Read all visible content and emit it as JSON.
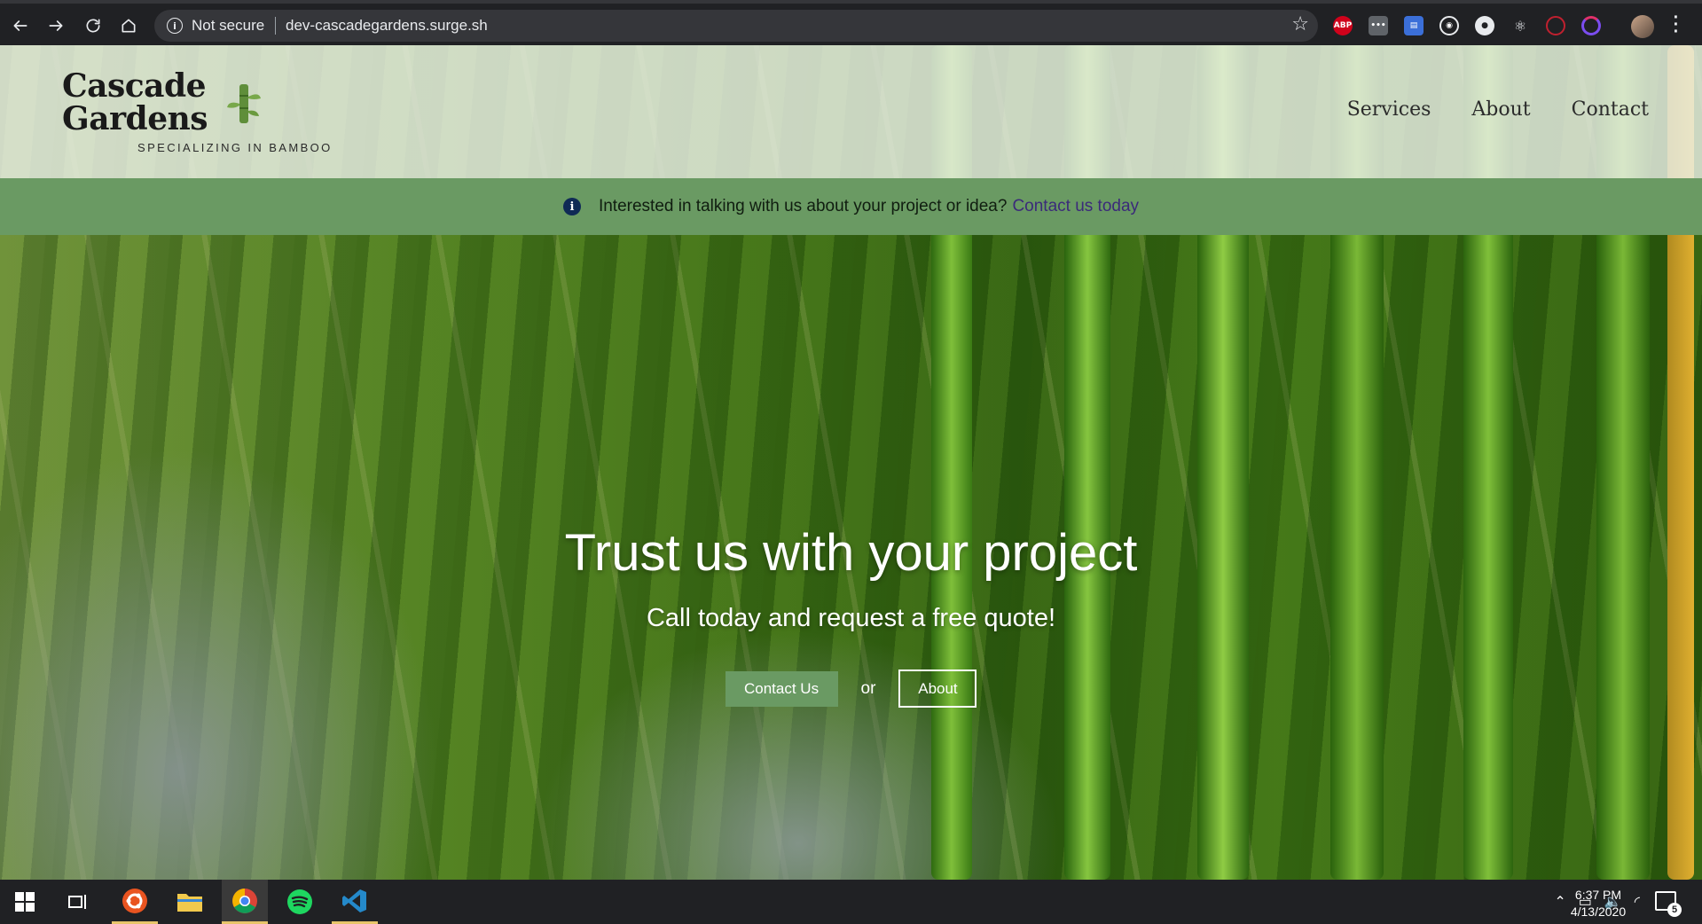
{
  "browser": {
    "security_label": "Not secure",
    "url": "dev-cascadegardens.surge.sh",
    "extensions": [
      "abp-icon",
      "more-icon",
      "bookmark-ext-icon",
      "target-icon",
      "github-icon",
      "react-icon",
      "opera-icon",
      "circle-ext-icon"
    ],
    "abp_label": "ABP"
  },
  "site": {
    "logo_line1": "Cascade",
    "logo_line2": "Gardens",
    "tagline": "SPECIALIZING IN BAMBOO",
    "nav": [
      "Services",
      "About",
      "Contact"
    ]
  },
  "banner": {
    "text": "Interested in talking with us about your project or idea?",
    "link": "Contact us today"
  },
  "hero": {
    "title": "Trust us with your project",
    "subtitle": "Call today and request a free quote!",
    "primary_button": "Contact Us",
    "or_text": "or",
    "secondary_button": "About"
  },
  "colors": {
    "accent_green": "#6a9a63",
    "banner_link": "#3b2a7a",
    "chrome_bg": "#202124"
  },
  "taskbar": {
    "apps": [
      "windows-start-icon",
      "task-view-icon",
      "ubuntu-icon",
      "file-explorer-icon",
      "chrome-icon",
      "spotify-icon",
      "vscode-icon"
    ],
    "time": "6:37 PM",
    "date": "4/13/2020",
    "notification_count": "5"
  }
}
